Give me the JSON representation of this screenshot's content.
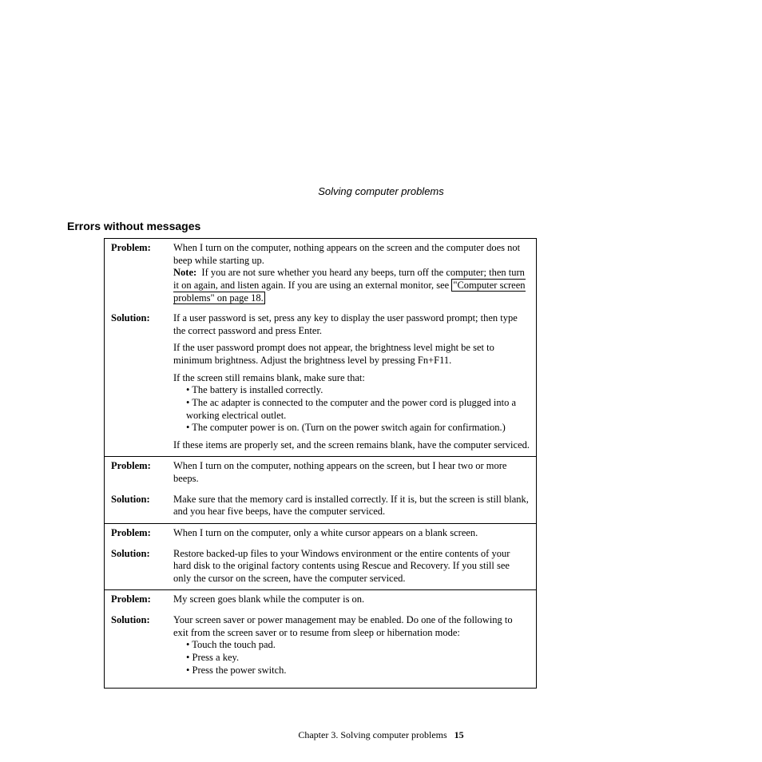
{
  "running_head": "Solving computer problems",
  "section_title": "Errors without messages",
  "entries": [
    {
      "problem_label": "Problem:",
      "problem": {
        "p1a": "When I turn on the computer, nothing appears on the screen and the computer does not beep while starting up.",
        "note_label": "Note:",
        "p1b": "If you are not sure whether you heard any beeps, turn off the computer; then turn it on again, and listen again. If you are using an external monitor, see ",
        "link": "\"Computer screen problems\" on page 18."
      },
      "solution_label": "Solution:",
      "solution": {
        "p1": "If a user password is set, press any key to display the user password prompt; then type the correct password and press Enter.",
        "p2": "If the user password prompt does not appear, the brightness level might be set to minimum brightness. Adjust the brightness level by pressing Fn+F11.",
        "p3": "If the screen still remains blank, make sure that:",
        "bullets": [
          "The battery is installed correctly.",
          "The ac adapter is connected to the computer and the power cord is plugged into a working electrical outlet.",
          "The computer power is on. (Turn on the power switch again for confirmation.)"
        ],
        "p4": "If these items are properly set, and the screen remains blank, have the computer serviced."
      }
    },
    {
      "problem_label": "Problem:",
      "problem": "When I turn on the computer, nothing appears on the screen, but I hear two or more beeps.",
      "solution_label": "Solution:",
      "solution": "Make sure that the memory card is installed correctly. If it is, but the screen is still blank, and you hear five beeps, have the computer serviced."
    },
    {
      "problem_label": "Problem:",
      "problem": "When I turn on the computer, only a white cursor appears on a blank screen.",
      "solution_label": "Solution:",
      "solution": "Restore backed-up files to your Windows environment or the entire contents of your hard disk to the original factory contents using Rescue and Recovery. If you still see only the cursor on the screen, have the computer serviced."
    },
    {
      "problem_label": "Problem:",
      "problem": "My screen goes blank while the computer is on.",
      "solution_label": "Solution:",
      "solution": {
        "p1": "Your screen saver or power management may be enabled. Do one of the following to exit from the screen saver or to resume from sleep or hibernation mode:",
        "bullets": [
          "Touch the touch pad.",
          "Press a key.",
          "Press the power switch."
        ]
      }
    }
  ],
  "footer": {
    "text": "Chapter 3. Solving computer problems",
    "page": "15"
  }
}
